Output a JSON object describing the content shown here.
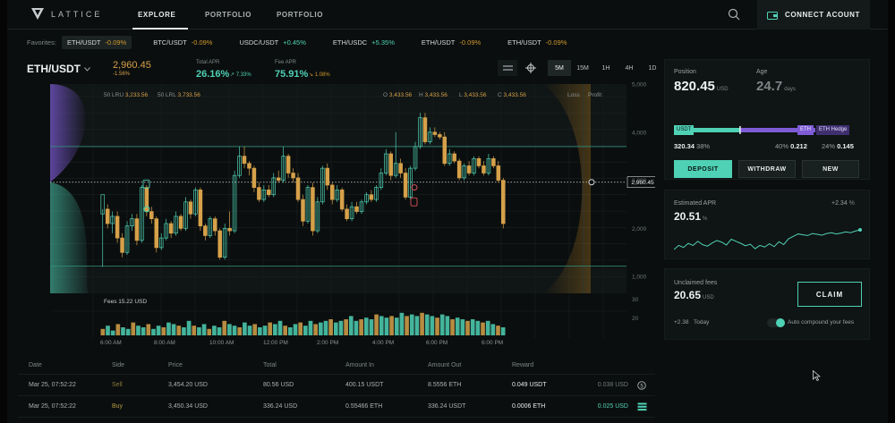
{
  "nav": {
    "logo_text": "LATTICE",
    "items": [
      "EXPLORE",
      "PORTFOLIO",
      "PORTFOLIO"
    ],
    "connect_label": "CONNECT ACOUNT"
  },
  "favorites": {
    "label": "Favorites:",
    "items": [
      {
        "pair": "ETH/USDT",
        "change": "-0.09%",
        "dir": "neg"
      },
      {
        "pair": "BTC/USDT",
        "change": "-0.09%",
        "dir": "neg"
      },
      {
        "pair": "USDC/USDT",
        "change": "+0.45%",
        "dir": "pos"
      },
      {
        "pair": "ETH/USDC",
        "change": "+5.35%",
        "dir": "pos"
      },
      {
        "pair": "ETH/USDT",
        "change": "-0.09%",
        "dir": "neg"
      },
      {
        "pair": "ETH/USDT",
        "change": "-0.09%",
        "dir": "neg"
      }
    ]
  },
  "header": {
    "pair": "ETH/USDT",
    "price": "2,960.45",
    "price_change": "-1.56%",
    "total_apr_label": "Total APR",
    "total_apr": "26.16%",
    "total_apr_delta": "7.33%",
    "fee_apr_label": "Fee APR",
    "fee_apr": "75.91%",
    "fee_apr_delta": "1.08%"
  },
  "timeframes": [
    "5M",
    "15M",
    "1H",
    "4H",
    "1D"
  ],
  "active_timeframe": "5M",
  "chart_info": {
    "lru": "50 LRU",
    "lru_val": "3,233.56",
    "lrl": "50 LRL",
    "lrl_val": "3,733.56",
    "o": "O",
    "o_val": "3,433.56",
    "h": "H",
    "h_val": "3,433.56",
    "l": "L",
    "l_val": "3,433.56",
    "c": "C",
    "c_val": "3,433.56",
    "loss": "Loss",
    "profit": "Profit",
    "fees_label": "Fees",
    "fees_val": "15.22 USD",
    "current_price_tag": "2,960.45"
  },
  "chart_data": {
    "type": "candlestick",
    "y_ticks": [
      "5,000",
      "4,000",
      "3,000",
      "2,000",
      "1,000"
    ],
    "y_values": [
      5000,
      4000,
      3000,
      2000,
      1000
    ],
    "fee_ticks": [
      "30",
      "20"
    ],
    "x_ticks": [
      "6:00 AM",
      "8:00 AM",
      "10:00 AM",
      "12:00 PM",
      "2:00 PM",
      "4:00 PM",
      "6:00 PM",
      "6:00 PM"
    ],
    "ylim": [
      650,
      5000
    ],
    "range_upper": 3700,
    "range_lower": 1220,
    "current_price": 2960.45,
    "candles": [
      [
        2300,
        2700,
        1200,
        2400
      ],
      [
        2400,
        2100,
        2000,
        2500
      ],
      [
        2100,
        2250,
        1900,
        2350
      ],
      [
        2250,
        1800,
        1700,
        2350
      ],
      [
        1800,
        1500,
        1400,
        1900
      ],
      [
        1500,
        2050,
        1450,
        2150
      ],
      [
        2050,
        2200,
        1950,
        2300
      ],
      [
        2200,
        1750,
        1650,
        2300
      ],
      [
        1750,
        2850,
        1700,
        2900
      ],
      [
        2850,
        2350,
        2250,
        2900
      ],
      [
        2350,
        2200,
        2100,
        2450
      ],
      [
        2200,
        1600,
        1500,
        2250
      ],
      [
        1600,
        1800,
        1550,
        1900
      ],
      [
        1800,
        2100,
        1750,
        2200
      ],
      [
        2100,
        1900,
        1800,
        2150
      ],
      [
        1900,
        2250,
        1850,
        2350
      ],
      [
        2250,
        2000,
        1950,
        2300
      ],
      [
        2000,
        2550,
        1950,
        2650
      ],
      [
        2550,
        2300,
        2200,
        2600
      ],
      [
        2300,
        2800,
        2250,
        2850
      ],
      [
        2800,
        2050,
        1950,
        2850
      ],
      [
        2050,
        1850,
        1750,
        2100
      ],
      [
        1850,
        2200,
        1800,
        2250
      ],
      [
        2200,
        1950,
        1850,
        2250
      ],
      [
        1950,
        1400,
        1350,
        2000
      ],
      [
        1400,
        2000,
        1350,
        2100
      ],
      [
        2000,
        1950,
        1850,
        2350
      ],
      [
        1950,
        3100,
        1900,
        3200
      ],
      [
        3100,
        3500,
        3050,
        3700
      ],
      [
        3500,
        3350,
        3250,
        3700
      ],
      [
        3350,
        3250,
        3100,
        3400
      ],
      [
        3250,
        2850,
        2750,
        3300
      ],
      [
        2850,
        2600,
        2550,
        2950
      ],
      [
        2600,
        2800,
        2550,
        2900
      ],
      [
        2800,
        2700,
        2650,
        2900
      ],
      [
        2700,
        3050,
        2650,
        3150
      ],
      [
        3050,
        3000,
        2950,
        3200
      ],
      [
        3000,
        3500,
        2950,
        3700
      ],
      [
        3500,
        3150,
        3050,
        3550
      ],
      [
        3150,
        3050,
        2950,
        3250
      ],
      [
        3050,
        2600,
        2550,
        3150
      ],
      [
        2600,
        2150,
        2050,
        2700
      ],
      [
        2150,
        2850,
        2100,
        2900
      ],
      [
        2850,
        1950,
        1850,
        2950
      ],
      [
        1950,
        2550,
        1900,
        2650
      ],
      [
        2550,
        3250,
        2500,
        3300
      ],
      [
        3250,
        2900,
        2800,
        3350
      ],
      [
        2900,
        2600,
        2500,
        2950
      ],
      [
        2600,
        2800,
        2550,
        2900
      ],
      [
        2800,
        2400,
        2350,
        2850
      ],
      [
        2400,
        2200,
        2150,
        2500
      ],
      [
        2200,
        2450,
        2150,
        2550
      ],
      [
        2450,
        2350,
        2300,
        2550
      ],
      [
        2350,
        2550,
        2300,
        2600
      ],
      [
        2550,
        2700,
        2500,
        2750
      ],
      [
        2700,
        2600,
        2550,
        2800
      ],
      [
        2600,
        2850,
        2550,
        2900
      ],
      [
        2850,
        3150,
        2800,
        3250
      ],
      [
        3150,
        3550,
        3100,
        3650
      ],
      [
        3550,
        3100,
        3000,
        3600
      ],
      [
        3100,
        3350,
        3050,
        4000
      ],
      [
        3350,
        3150,
        3050,
        3450
      ],
      [
        3150,
        2650,
        2600,
        3250
      ],
      [
        2650,
        3250,
        2600,
        3300
      ],
      [
        3250,
        3700,
        3200,
        3800
      ],
      [
        3700,
        4300,
        3650,
        4400
      ],
      [
        4300,
        3800,
        3750,
        4400
      ],
      [
        3800,
        4000,
        3750,
        4100
      ],
      [
        4000,
        3950,
        3900,
        4100
      ],
      [
        3950,
        3900,
        3850,
        4000
      ],
      [
        3900,
        3350,
        3300,
        4000
      ],
      [
        3350,
        3550,
        3300,
        3650
      ],
      [
        3550,
        3400,
        3350,
        3600
      ],
      [
        3400,
        3050,
        3000,
        3450
      ],
      [
        3050,
        3300,
        3000,
        3350
      ],
      [
        3300,
        3150,
        3100,
        3400
      ],
      [
        3150,
        3450,
        3100,
        3500
      ],
      [
        3450,
        3300,
        3250,
        3500
      ],
      [
        3300,
        3150,
        3100,
        3400
      ],
      [
        3150,
        3450,
        3100,
        3550
      ],
      [
        3450,
        3300,
        3250,
        3500
      ],
      [
        3300,
        3000,
        2950,
        3400
      ],
      [
        3000,
        2100,
        2000,
        3050
      ]
    ],
    "fee_bars": [
      4,
      6,
      3,
      7,
      5,
      4,
      8,
      6,
      5,
      7,
      4,
      6,
      5,
      8,
      7,
      6,
      5,
      9,
      6,
      5,
      7,
      4,
      6,
      5,
      9,
      7,
      6,
      5,
      8,
      6,
      7,
      5,
      6,
      8,
      7,
      9,
      6,
      5,
      7,
      8,
      6,
      9,
      7,
      8,
      9,
      10,
      8,
      9,
      10,
      12,
      9,
      10,
      11,
      10,
      13,
      12,
      11,
      12,
      11,
      14,
      12,
      13,
      12,
      14,
      13,
      12,
      11,
      13,
      12,
      10,
      11,
      10,
      9,
      10,
      9,
      8,
      9,
      7,
      6,
      5
    ]
  },
  "trades": {
    "headers": [
      "Date",
      "Side",
      "Price",
      "Total",
      "Amount In",
      "Amount Out",
      "Reward"
    ],
    "rows": [
      {
        "date": "Mar 25, 07:52:22",
        "side": "Sell",
        "price": "3,454.20 USD",
        "total": "80.56 USD",
        "amount_in": "400.15 USDT",
        "amount_out": "8.5556 ETH",
        "reward": "0.049 USDT",
        "reward_usd": "0.038 USD"
      },
      {
        "date": "Mar 25, 07:52:22",
        "side": "Buy",
        "price": "3,450.34 USD",
        "total": "336.24 USD",
        "amount_in": "0.55466 ETH",
        "amount_out": "336.24 USDT",
        "reward": "0.0006 ETH",
        "reward_usd": "0.025 USD"
      }
    ]
  },
  "position": {
    "label": "Position",
    "value": "820.45",
    "unit": "USD",
    "age_label": "Age",
    "age_value": "24.7",
    "age_unit": "days",
    "usdt_tag": "USDT",
    "eth_tag": "ETH",
    "hedge_tag": "ETH Hedge",
    "usdt_amount": "320.34",
    "usdt_pct": "38%",
    "eth_pct": "40%",
    "eth_amount": "0.212",
    "hedge_pct": "24%",
    "hedge_amount": "0.145",
    "alloc_usdt": 0.38,
    "alloc_eth": 0.4,
    "deposit": "DEPOSIT",
    "withdraw": "WITHDRAW",
    "new": "NEW"
  },
  "apr_card": {
    "label": "Estimated APR",
    "value": "20.51",
    "unit": "%",
    "delta": "+2.34",
    "delta_unit": "%",
    "series": [
      2,
      3,
      2.5,
      3.5,
      3,
      4,
      3.2,
      2.8,
      3.6,
      4.2,
      3.8,
      3.1,
      4.5,
      4,
      3.5,
      2.9,
      3.3,
      2.2,
      3,
      2.6,
      3.4,
      2.7,
      3.9,
      3.2,
      4.6,
      5.2,
      5.8,
      5.6,
      5.4,
      5.9,
      5.7,
      5.5,
      5.9,
      6.1,
      5.8,
      6,
      6.3,
      6.1,
      6.5,
      6.8
    ]
  },
  "fees_card": {
    "label": "Unclaimed fees",
    "value": "20.65",
    "unit": "USD",
    "claim": "CLAIM",
    "delta": "+2.38",
    "delta_label": "Today",
    "auto_label": "Auto compound your fees",
    "auto_on": true
  },
  "colors": {
    "accent": "#4fd1b5",
    "warn": "#d6a14a",
    "purple": "#7d5bd6",
    "bg": "#0b0e0e"
  }
}
